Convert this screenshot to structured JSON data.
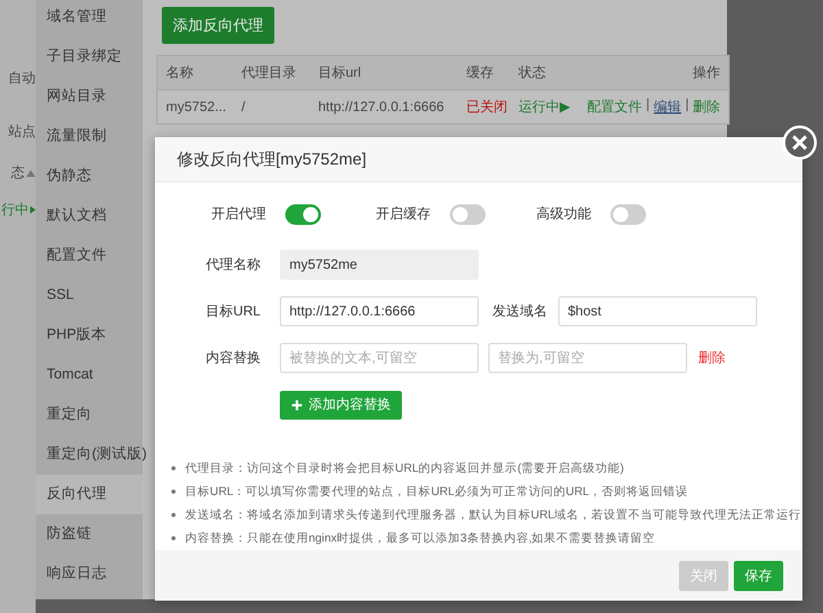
{
  "page_edge": {
    "texts": [
      "自动",
      "站点",
      "态",
      "行中"
    ]
  },
  "sidebar": {
    "items": [
      {
        "label": "域名管理",
        "selected": false
      },
      {
        "label": "子目录绑定",
        "selected": false
      },
      {
        "label": "网站目录",
        "selected": false
      },
      {
        "label": "流量限制",
        "selected": false
      },
      {
        "label": "伪静态",
        "selected": false
      },
      {
        "label": "默认文档",
        "selected": false
      },
      {
        "label": "配置文件",
        "selected": false
      },
      {
        "label": "SSL",
        "selected": false
      },
      {
        "label": "PHP版本",
        "selected": false
      },
      {
        "label": "Tomcat",
        "selected": false
      },
      {
        "label": "重定向",
        "selected": false
      },
      {
        "label": "重定向(测试版)",
        "selected": false
      },
      {
        "label": "反向代理",
        "selected": true
      },
      {
        "label": "防盗链",
        "selected": false
      },
      {
        "label": "响应日志",
        "selected": false
      }
    ]
  },
  "content": {
    "add_button": "添加反向代理",
    "table": {
      "columns": [
        "名称",
        "代理目录",
        "目标url",
        "缓存",
        "状态",
        "操作"
      ],
      "rows": [
        {
          "name": "my5752...",
          "directory": "/",
          "url": "http://127.0.0.1:6666",
          "cache": {
            "text": "已关闭",
            "on": false
          },
          "status": "运行中▶",
          "actions": [
            {
              "label": "配置文件",
              "hovered": false
            },
            {
              "label": "编辑",
              "hovered": true
            },
            {
              "label": "删除",
              "hovered": false
            }
          ],
          "separator": "|"
        }
      ]
    }
  },
  "modal": {
    "title": "修改反向代理[my5752me]",
    "toggles": [
      {
        "label": "开启代理",
        "on": true
      },
      {
        "label": "开启缓存",
        "on": false
      },
      {
        "label": "高级功能",
        "on": false
      }
    ],
    "proxy_name": {
      "label": "代理名称",
      "value": "my5752me",
      "disabled": true
    },
    "target_url": {
      "label": "目标URL",
      "value": "http://127.0.0.1:6666"
    },
    "send_domain": {
      "label": "发送域名",
      "value": "$host"
    },
    "replace": {
      "label": "内容替换",
      "from_placeholder": "被替换的文本,可留空",
      "to_placeholder": "替换为,可留空",
      "delete": "删除"
    },
    "add_replace_button": "添加内容替换",
    "notes": [
      "代理目录：访问这个目录时将会把目标URL的内容返回并显示(需要开启高级功能)",
      "目标URL：可以填写你需要代理的站点，目标URL必须为可正常访问的URL，否则将返回错误",
      "发送域名：将域名添加到请求头传递到代理服务器，默认为目标URL域名，若设置不当可能导致代理无法正常运行",
      "内容替换：只能在使用nginx时提供，最多可以添加3条替换内容,如果不需要替换请留空"
    ],
    "buttons": [
      {
        "label": "关闭",
        "kind": "secondary"
      },
      {
        "label": "保存",
        "kind": "primary"
      }
    ]
  }
}
